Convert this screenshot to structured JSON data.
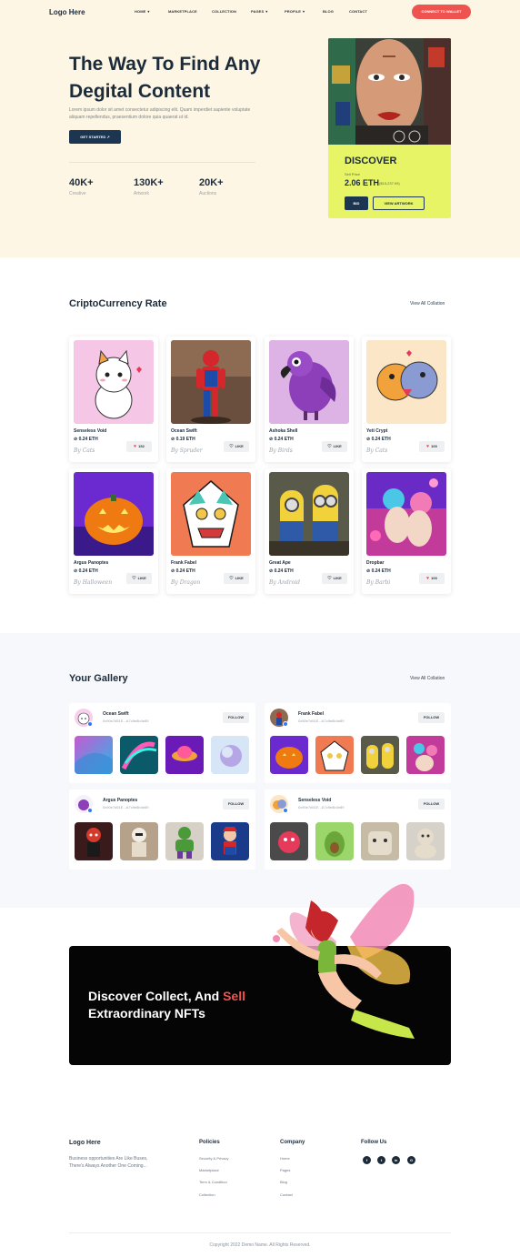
{
  "header": {
    "logo": "Logo Here",
    "nav": [
      {
        "label": "HOME",
        "dropdown": true
      },
      {
        "label": "MARKETPLACE",
        "dropdown": false
      },
      {
        "label": "COLLECTION",
        "dropdown": false
      },
      {
        "label": "PAGES",
        "dropdown": true
      },
      {
        "label": "PROFILE",
        "dropdown": true
      },
      {
        "label": "BLOG",
        "dropdown": false
      },
      {
        "label": "CONTACT",
        "dropdown": false
      }
    ],
    "connect_label": "CONNECT TO WALLET"
  },
  "hero": {
    "title": "The Way To Find Any Degital Content",
    "description": "Lorem ipsum dolor sit amet consectetur adipiscing elit. Quam imperdiet sapiente voluptate aliquam repellendus, praesentium dolore quia quaerat ut id.",
    "cta_label": "GET STARTED ↗",
    "stats": [
      {
        "value": "40K+",
        "label": "Creative"
      },
      {
        "value": "130K+",
        "label": "Artwork"
      },
      {
        "value": "20K+",
        "label": "Auctions"
      }
    ],
    "discover": {
      "title": "DISCOVER",
      "sell_label": "Sell Price",
      "eth": "2.06 ETH",
      "usd": "($15,237.09)",
      "bid_label": "BID",
      "view_label": "VIEW ARTWORK"
    }
  },
  "crypto": {
    "title": "CriptoCurrency Rate",
    "view_all": "View All Collation",
    "cards": [
      {
        "name": "Senseless Void",
        "price": "⊘ 0.24 ETH",
        "by": "By Cats",
        "like": "152",
        "liked": true
      },
      {
        "name": "Ocean Swift",
        "price": "⊘ 0.19 ETH",
        "by": "By Spruder",
        "like": "LIKE",
        "liked": false
      },
      {
        "name": "Ashoka Shell",
        "price": "⊘ 0.24 ETH",
        "by": "By Birds",
        "like": "LIKE",
        "liked": false
      },
      {
        "name": "Yeti Crypt",
        "price": "⊘ 0.24 ETH",
        "by": "By Cats",
        "like": "100",
        "liked": true
      },
      {
        "name": "Argus Panoptes",
        "price": "⊘ 0.24 ETH",
        "by": "By Halloween",
        "like": "LIKE",
        "liked": false
      },
      {
        "name": "Frank Fabel",
        "price": "⊘ 0.24 ETH",
        "by": "By Dragon",
        "like": "LIKE",
        "liked": false
      },
      {
        "name": "Great Ape",
        "price": "⊘ 0.24 ETH",
        "by": "By Android",
        "like": "LIKE",
        "liked": false
      },
      {
        "name": "Dropbar",
        "price": "⊘ 0.24 ETH",
        "by": "By Barbi",
        "like": "100",
        "liked": true
      }
    ]
  },
  "gallery": {
    "title": "Your Gallery",
    "view_all": "View All Collation",
    "users": [
      {
        "name": "Ocean Swift",
        "hash": "0x90e7d51E...A7c9e8b4e89",
        "follow": "FOLLOW"
      },
      {
        "name": "Frank Fabel",
        "hash": "0x90e7d51E...A7c9e8b4e89",
        "follow": "FOLLOW"
      },
      {
        "name": "Argus Panoptes",
        "hash": "0x90e7d51E...A7c9e8b4e89",
        "follow": "FOLLOW"
      },
      {
        "name": "Senseless Void",
        "hash": "0x90e7d51E...A7c9e8b4e89",
        "follow": "FOLLOW"
      }
    ]
  },
  "banner": {
    "text_part1": "Discover Collect, And ",
    "accent": "Sell",
    "text_part2": "Extraordinary NFTs"
  },
  "footer": {
    "logo": "Logo Here",
    "description": "Business opportunities Are Like Buses, There's Always Another One Coming...",
    "policies_title": "Policies",
    "policies": [
      "Security & Privacy",
      "Marketplace",
      "Term & Condition",
      "Collection"
    ],
    "company_title": "Company",
    "company": [
      "Home",
      "Pages",
      "Blog",
      "Contact"
    ],
    "follow_title": "Follow Us",
    "social": [
      "f",
      "t",
      "in",
      "G"
    ],
    "copyright": "Copyright 2022 Demo Name. All Rights Reserved."
  },
  "colors": {
    "hero_bg": "#fef6e4",
    "accent_red": "#ef5350",
    "navy": "#1c3550",
    "discover_yellow": "#e6f466"
  }
}
